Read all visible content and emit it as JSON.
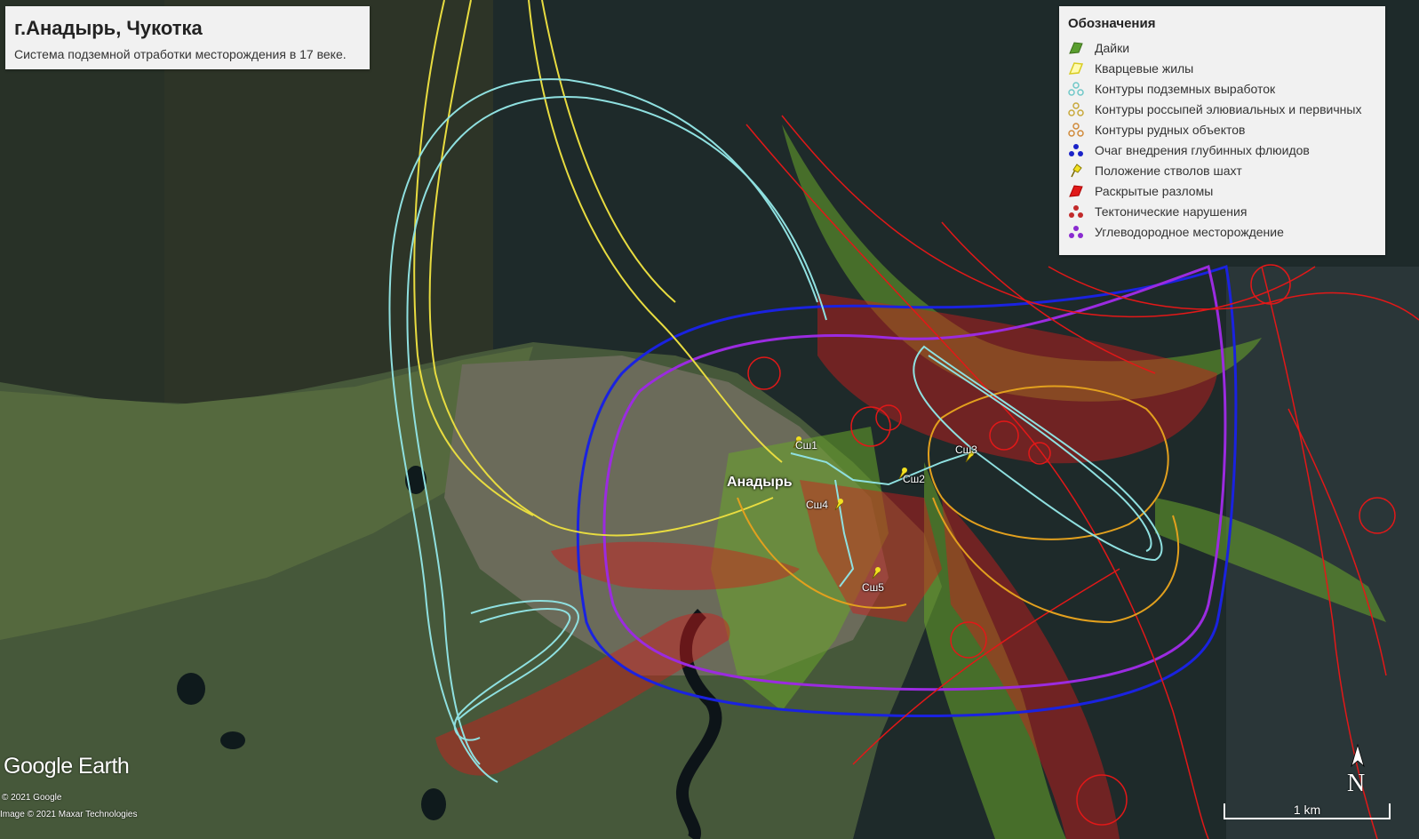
{
  "title": "г.Анадырь, Чукотка",
  "subtitle": "Система подземной отработки месторождения в 17 веке.",
  "legend": {
    "title": "Обозначения",
    "items": [
      {
        "label": "Дайки",
        "color": "#5a9e2f",
        "icon": "polygon-icon"
      },
      {
        "label": "Кварцевые жилы",
        "color": "#f2ec6b",
        "icon": "polygon-outline-icon"
      },
      {
        "label": "Контуры подземных выработок",
        "color": "#7fd6d6",
        "icon": "path-icon"
      },
      {
        "label": "Контуры россыпей элювиальных и первичных",
        "color": "#d4b84a",
        "icon": "path-icon"
      },
      {
        "label": "Контуры рудных объектов",
        "color": "#d08a3a",
        "icon": "path-icon"
      },
      {
        "label": "Очаг внедрения глубинных флюидов",
        "color": "#1a2bd0",
        "icon": "path-icon"
      },
      {
        "label": "Положение стволов шахт",
        "color": "#f2e020",
        "icon": "pushpin-icon"
      },
      {
        "label": "Раскрытые разломы",
        "color": "#e01a1a",
        "icon": "polygon-icon"
      },
      {
        "label": "Тектонические нарушения",
        "color": "#c22a2a",
        "icon": "path-icon"
      },
      {
        "label": "Углеводородное месторождение",
        "color": "#8a2bd0",
        "icon": "path-icon"
      }
    ]
  },
  "map_labels": {
    "city": "Анадырь",
    "shafts": [
      "Сш1",
      "Сш2",
      "Сш3",
      "Сш4",
      "Сш5"
    ]
  },
  "branding": {
    "logo_text": "Google Earth",
    "copyright_1": "© 2021 Google",
    "copyright_2": "Image © 2021 Maxar Technologies"
  },
  "scale_label": "1 km",
  "north_label": "N"
}
